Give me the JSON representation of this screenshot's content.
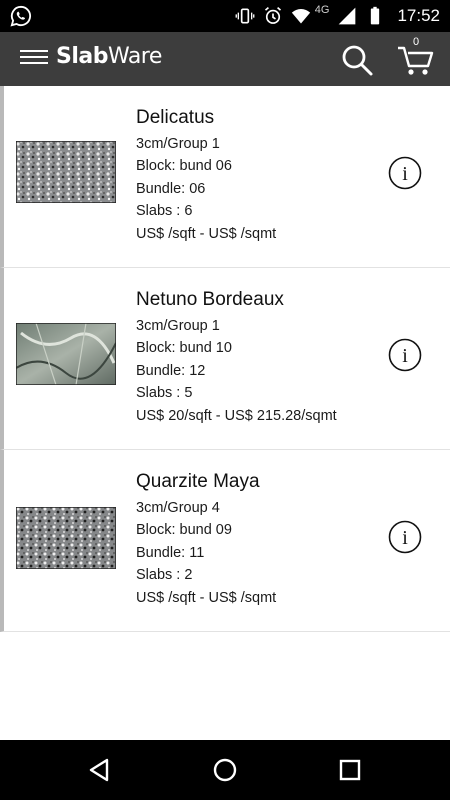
{
  "status_bar": {
    "network": "4G",
    "time": "17:52",
    "icons": [
      "whatsapp-icon",
      "vibrate-icon",
      "alarm-icon",
      "wifi-icon",
      "signal-icon",
      "battery-icon"
    ]
  },
  "app_bar": {
    "brand_bold": "Slab",
    "brand_light": "Ware",
    "cart_count": "0",
    "background": "#3d3d3d"
  },
  "products": [
    {
      "name": "Delicatus",
      "thickness_group": "3cm/Group 1",
      "block": "Block: bund 06",
      "bundle": "Bundle: 06",
      "slabs": "Slabs : 6",
      "price": "US$ /sqft - US$ /sqmt"
    },
    {
      "name": "Netuno Bordeaux",
      "thickness_group": "3cm/Group 1",
      "block": "Block: bund 10",
      "bundle": "Bundle: 12",
      "slabs": "Slabs : 5",
      "price": "US$ 20/sqft - US$ 215.28/sqmt"
    },
    {
      "name": "Quarzite Maya",
      "thickness_group": "3cm/Group 4",
      "block": "Block: bund 09",
      "bundle": "Bundle: 11",
      "slabs": "Slabs : 2",
      "price": "US$ /sqft - US$ /sqmt"
    }
  ],
  "nav_bar": {
    "buttons": [
      "back-icon",
      "home-icon",
      "recents-icon"
    ]
  }
}
